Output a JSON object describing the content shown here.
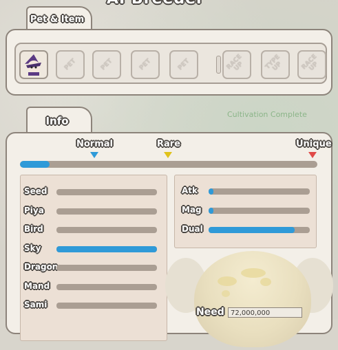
{
  "window": {
    "title": "AI Breeder"
  },
  "pet_tab": {
    "label": "Pet & Item"
  },
  "slots": [
    {
      "name": "pet-slot-1",
      "type": "pet",
      "label": "",
      "filled": true
    },
    {
      "name": "pet-slot-2",
      "type": "pet",
      "label": "PET",
      "filled": false
    },
    {
      "name": "pet-slot-3",
      "type": "pet",
      "label": "PET",
      "filled": false
    },
    {
      "name": "pet-slot-4",
      "type": "pet",
      "label": "PET",
      "filled": false
    },
    {
      "name": "pet-slot-5",
      "type": "pet",
      "label": "PET",
      "filled": false
    },
    {
      "name": "item-slot-race-up-1",
      "type": "item",
      "label": "RACE UP",
      "filled": false
    },
    {
      "name": "item-slot-type-up",
      "type": "item",
      "label": "TYPE UP",
      "filled": false
    },
    {
      "name": "item-slot-race-up-2",
      "type": "item",
      "label": "RACE UP",
      "filled": false
    }
  ],
  "info_tab": {
    "label": "Info"
  },
  "grades": {
    "normal": {
      "label": "Normal",
      "color": "#2f9ad8"
    },
    "rare": {
      "label": "Rare",
      "color": "#e0c21a"
    },
    "unique": {
      "label": "Unique",
      "color": "#e04a48"
    }
  },
  "grade_progress": 0.1,
  "race_stats": [
    {
      "label": "Seed",
      "value": 0
    },
    {
      "label": "Piya",
      "value": 0
    },
    {
      "label": "Bird",
      "value": 0
    },
    {
      "label": "Sky",
      "value": 1
    },
    {
      "label": "Dragon",
      "value": 0
    },
    {
      "label": "Mand",
      "value": 0
    },
    {
      "label": "Sami",
      "value": 0
    }
  ],
  "type_stats": [
    {
      "label": "Atk",
      "value": 0.05
    },
    {
      "label": "Mag",
      "value": 0.05
    },
    {
      "label": "Dual",
      "value": 0.85
    }
  ],
  "need": {
    "label": "Need",
    "value": "72,000,000"
  },
  "colors": {
    "accent": "#2f9ad8",
    "panel": "#f3efe8",
    "border": "#8c837a"
  },
  "ghost_text": "Cultivation Complete"
}
